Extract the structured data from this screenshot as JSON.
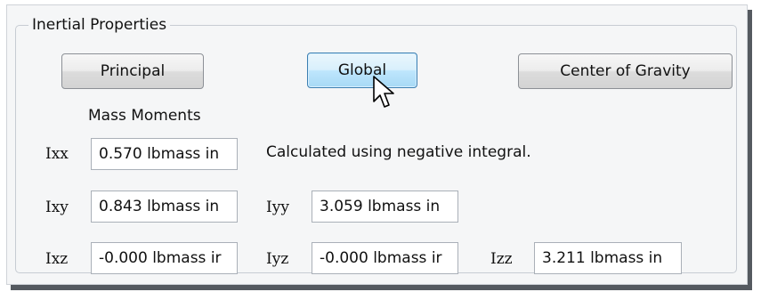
{
  "group": {
    "title": "Inertial Properties"
  },
  "buttons": {
    "principal": "Principal",
    "global": "Global",
    "center_of_gravity": "Center of Gravity"
  },
  "mass_moments_label": "Mass Moments",
  "note": "Calculated using negative integral.",
  "fields": {
    "ixx": {
      "label": "Ixx",
      "value": "0.570 lbmass in"
    },
    "ixy": {
      "label": "Ixy",
      "value": "0.843 lbmass in"
    },
    "iyy": {
      "label": "Iyy",
      "value": "3.059 lbmass in"
    },
    "ixz": {
      "label": "Ixz",
      "value": "-0.000 lbmass ir"
    },
    "iyz": {
      "label": "Iyz",
      "value": "-0.000 lbmass ir"
    },
    "izz": {
      "label": "Izz",
      "value": "3.211 lbmass in"
    }
  },
  "icons": {
    "cursor": "mouse-pointer-icon"
  }
}
